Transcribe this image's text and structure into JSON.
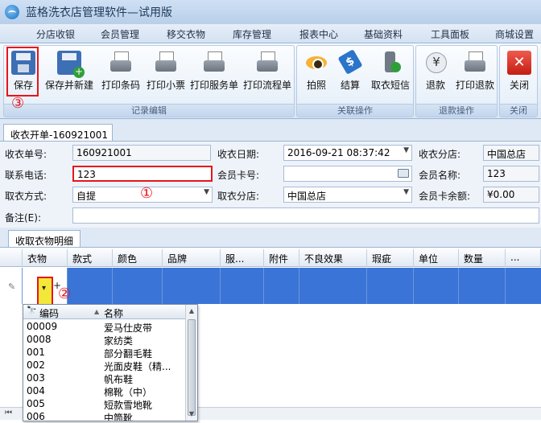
{
  "window": {
    "title": "蓝格洗衣店管理软件—试用版"
  },
  "menu": [
    "分店收银",
    "会员管理",
    "移交衣物",
    "库存管理",
    "报表中心",
    "基础资料",
    "工具面板",
    "商城设置"
  ],
  "ribbon": {
    "groups": [
      {
        "label": "记录编辑",
        "buttons": [
          {
            "label": "保存",
            "icon": "save-icon"
          },
          {
            "label": "保存并新建",
            "icon": "save-new-icon"
          },
          {
            "label": "打印条码",
            "icon": "printer-icon"
          },
          {
            "label": "打印小票",
            "icon": "printer-icon"
          },
          {
            "label": "打印服务单",
            "icon": "printer-icon"
          },
          {
            "label": "打印流程单",
            "icon": "printer-icon"
          }
        ]
      },
      {
        "label": "关联操作",
        "buttons": [
          {
            "label": "拍照",
            "icon": "camera-eye-icon"
          },
          {
            "label": "结算",
            "icon": "price-tag-icon"
          },
          {
            "label": "取衣短信",
            "icon": "phone-sms-icon"
          }
        ]
      },
      {
        "label": "退款操作",
        "buttons": [
          {
            "label": "退款",
            "icon": "yen-coin-icon"
          },
          {
            "label": "打印退款",
            "icon": "printer-icon"
          }
        ]
      },
      {
        "label": "关闭",
        "buttons": [
          {
            "label": "关闭",
            "icon": "close-icon"
          }
        ]
      }
    ]
  },
  "annotations": {
    "circle1": "①",
    "circle2": "②",
    "circle3": "③"
  },
  "doc_tab": "收衣开单-160921001",
  "form": {
    "order_no_label": "收衣单号:",
    "order_no": "160921001",
    "date_label": "收衣日期:",
    "date": "2016-09-21 08:37:42",
    "branch_label": "收衣分店:",
    "branch": "中国总店",
    "phone_label": "联系电话:",
    "phone": "123",
    "card_label": "会员卡号:",
    "card_no": "",
    "member_name_label": "会员名称:",
    "member_name": "123",
    "pickup_method_label": "取衣方式:",
    "pickup_method": "自提",
    "pickup_branch_label": "取衣分店:",
    "pickup_branch": "中国总店",
    "balance_label": "会员卡余额:",
    "balance": "¥0.00",
    "remark_label": "备注(E):",
    "remark": ""
  },
  "detail_tab": "收取衣物明细",
  "grid": {
    "columns": [
      "衣物",
      "款式",
      "颜色",
      "品牌",
      "服...",
      "附件",
      "不良效果",
      "瑕疵",
      "单位",
      "数量",
      "..."
    ]
  },
  "dropdown": {
    "col_code": "编码",
    "col_name": "名称",
    "rows": [
      {
        "code": "00009",
        "name": "爱马仕皮带"
      },
      {
        "code": "0008",
        "name": "家纺类"
      },
      {
        "code": "001",
        "name": "部分翻毛鞋"
      },
      {
        "code": "002",
        "name": "光面皮鞋（精..."
      },
      {
        "code": "003",
        "name": "帆布鞋"
      },
      {
        "code": "004",
        "name": "棉靴（中）"
      },
      {
        "code": "005",
        "name": "短款雪地靴"
      },
      {
        "code": "006",
        "name": "中筒靴"
      }
    ]
  }
}
